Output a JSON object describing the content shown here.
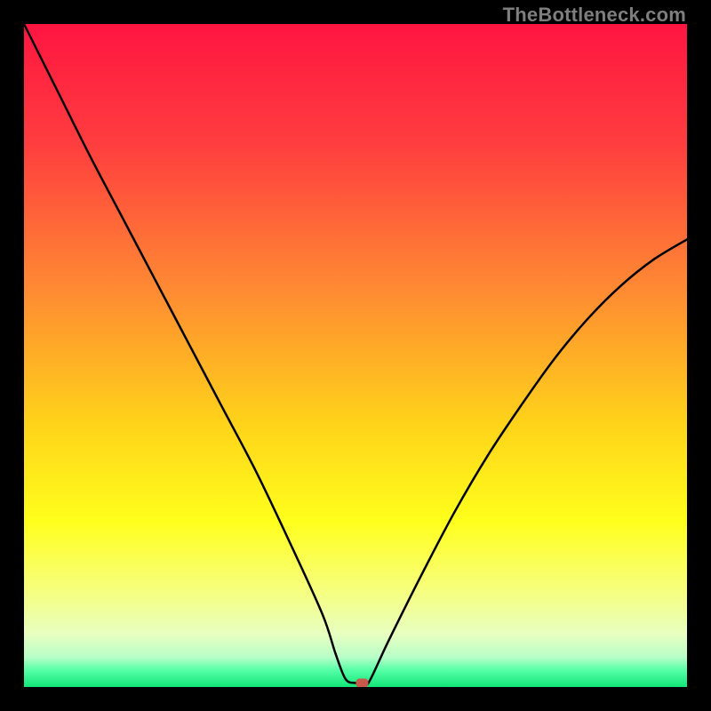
{
  "watermark": "TheBottleneck.com",
  "chart_data": {
    "type": "line",
    "title": "",
    "xlabel": "",
    "ylabel": "",
    "xlim": [
      0,
      100
    ],
    "ylim": [
      0,
      100
    ],
    "x": [
      0,
      5,
      10,
      15,
      20,
      25,
      30,
      35,
      40,
      45,
      47,
      48.5,
      50,
      51,
      52,
      55,
      60,
      65,
      70,
      75,
      80,
      85,
      90,
      95,
      100
    ],
    "y": [
      100,
      90,
      80,
      70.5,
      61,
      51.5,
      42,
      32.5,
      22,
      11,
      5,
      1.2,
      0.6,
      0.6,
      0.7,
      7,
      17,
      26.5,
      35,
      42.5,
      49.5,
      55.5,
      60.5,
      64.5,
      67.5
    ],
    "marker": {
      "x": 51,
      "y": 0.6,
      "color": "#c75a4a"
    },
    "gradient_stops": [
      {
        "offset": 0.0,
        "color": "#ff1541"
      },
      {
        "offset": 0.18,
        "color": "#ff3d3f"
      },
      {
        "offset": 0.4,
        "color": "#ff8a33"
      },
      {
        "offset": 0.6,
        "color": "#ffd21a"
      },
      {
        "offset": 0.75,
        "color": "#ffff1c"
      },
      {
        "offset": 0.85,
        "color": "#f7ff7a"
      },
      {
        "offset": 0.92,
        "color": "#e8ffc0"
      },
      {
        "offset": 0.955,
        "color": "#b8ffc8"
      },
      {
        "offset": 0.975,
        "color": "#54ffa6"
      },
      {
        "offset": 1.0,
        "color": "#12e67a"
      }
    ]
  }
}
